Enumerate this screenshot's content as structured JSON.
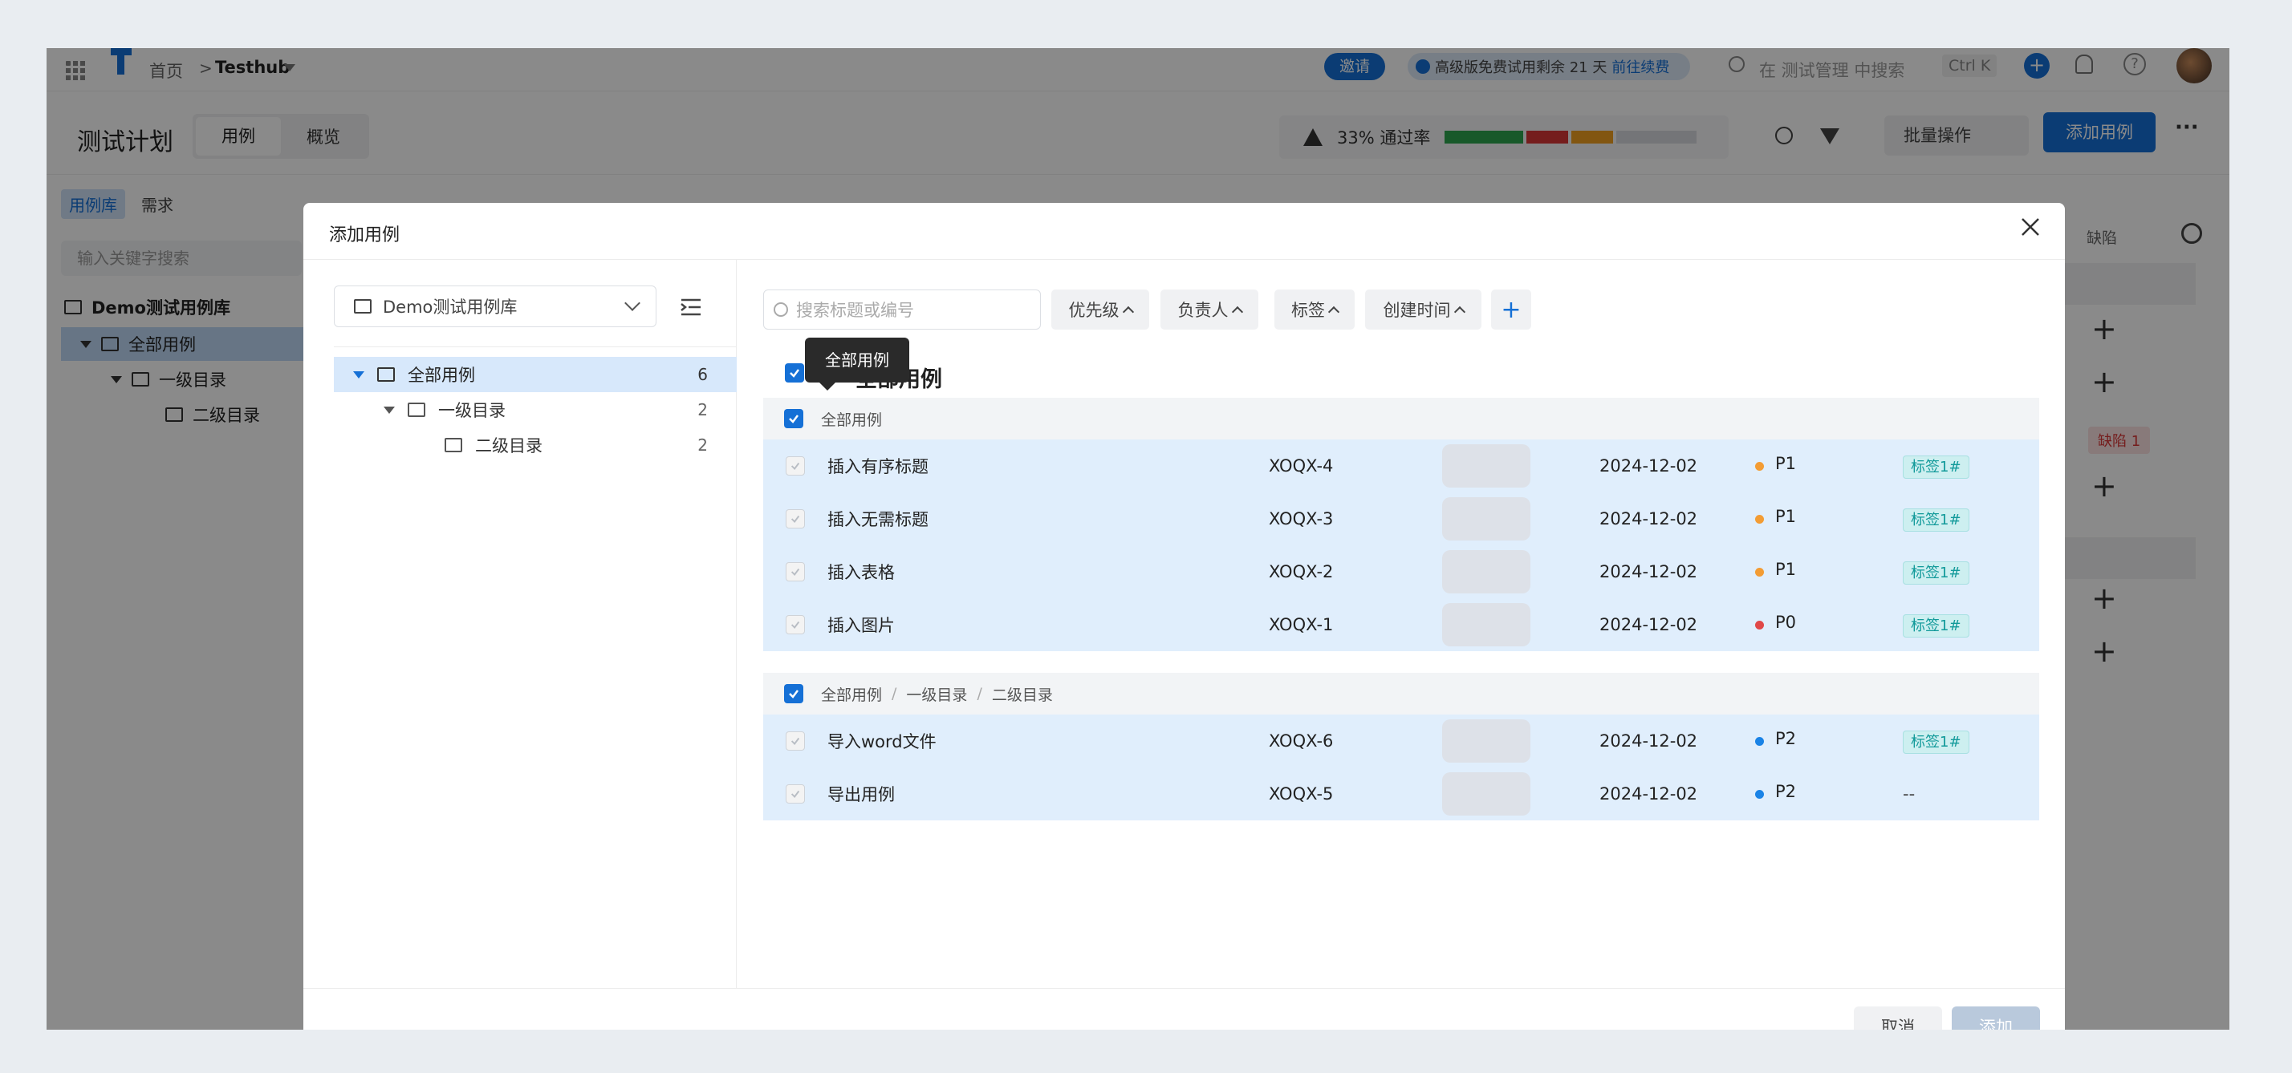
{
  "topbar": {
    "breadcrumb_home": "首页",
    "breadcrumb_sep": ">",
    "project": "Testhub",
    "invite": "邀请",
    "trial_text": "高级版免费试用剩余 21 天",
    "trial_link": "前往续费",
    "search_placeholder": "在 测试管理 中搜索",
    "shortcut": "Ctrl K"
  },
  "header": {
    "title": "测试计划",
    "tabs": [
      "用例",
      "概览"
    ],
    "pass_rate": "33% 通过率",
    "batch_label": "批量操作",
    "add_case_label": "添加用例",
    "more": "···"
  },
  "left_panel": {
    "tabs": [
      "用例库",
      "需求"
    ],
    "search_placeholder": "输入关键字搜索",
    "library": "Demo测试用例库",
    "tree": [
      "全部用例",
      "一级目录",
      "二级目录"
    ]
  },
  "right_panel": {
    "col_label": "缺陷",
    "defect_badge": "缺陷 1"
  },
  "modal": {
    "title": "添加用例",
    "library_select": "Demo测试用例库",
    "tree": [
      {
        "label": "全部用例",
        "count": "6"
      },
      {
        "label": "一级目录",
        "count": "2"
      },
      {
        "label": "二级目录",
        "count": "2"
      }
    ],
    "search_placeholder": "搜索标题或编号",
    "filters": [
      "优先级",
      "负责人",
      "标签",
      "创建时间"
    ],
    "add_filter": "+",
    "tooltip": "全部用例",
    "select_all_label": "全部用例",
    "group1_header": "全部用例",
    "group1_rows": [
      {
        "title": "插入有序标题",
        "id": "XOQX-4",
        "date": "2024-12-02",
        "priority": "P1",
        "tag": "标签1#"
      },
      {
        "title": "插入无需标题",
        "id": "XOQX-3",
        "date": "2024-12-02",
        "priority": "P1",
        "tag": "标签1#"
      },
      {
        "title": "插入表格",
        "id": "XOQX-2",
        "date": "2024-12-02",
        "priority": "P1",
        "tag": "标签1#"
      },
      {
        "title": "插入图片",
        "id": "XOQX-1",
        "date": "2024-12-02",
        "priority": "P0",
        "tag": "标签1#"
      }
    ],
    "group2_header": [
      "全部用例",
      "一级目录",
      "二级目录"
    ],
    "group2_sep": "/",
    "group2_rows": [
      {
        "title": "导入word文件",
        "id": "XOQX-6",
        "date": "2024-12-02",
        "priority": "P2",
        "tag": "标签1#"
      },
      {
        "title": "导出用例",
        "id": "XOQX-5",
        "date": "2024-12-02",
        "priority": "P2",
        "tag": "--"
      }
    ],
    "cancel": "取消",
    "confirm": "添加"
  },
  "colors": {
    "primary": "#1570d6",
    "p1": "#f39c34",
    "p0": "#e04848",
    "p2": "#1a83e6",
    "selected_row": "#e0eefc",
    "pass": "#2ea44f",
    "fail": "#d93636",
    "blocked": "#f0a020",
    "untested": "#d6d9de"
  },
  "pass_bar": {
    "pass": 0.33,
    "fail": 0.17,
    "blocked": 0.17,
    "untested": 0.33
  }
}
